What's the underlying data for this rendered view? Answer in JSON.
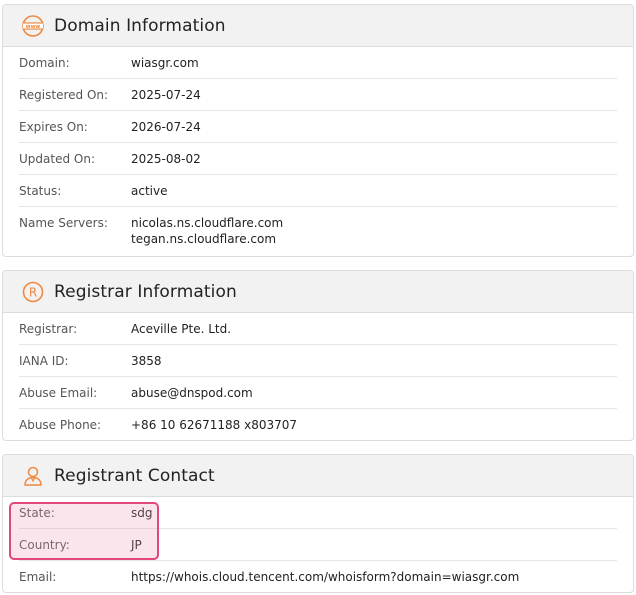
{
  "domain_info": {
    "title": "Domain Information",
    "icon": "www-globe-icon",
    "rows": [
      {
        "label": "Domain:",
        "value": "wiasgr.com"
      },
      {
        "label": "Registered On:",
        "value": "2025-07-24"
      },
      {
        "label": "Expires On:",
        "value": "2026-07-24"
      },
      {
        "label": "Updated On:",
        "value": "2025-08-02"
      },
      {
        "label": "Status:",
        "value": "active"
      }
    ],
    "name_servers": {
      "label": "Name Servers:",
      "values": [
        "nicolas.ns.cloudflare.com",
        "tegan.ns.cloudflare.com"
      ]
    }
  },
  "registrar_info": {
    "title": "Registrar Information",
    "icon": "registered-trademark-icon",
    "rows": [
      {
        "label": "Registrar:",
        "value": "Aceville Pte. Ltd."
      },
      {
        "label": "IANA ID:",
        "value": "3858"
      },
      {
        "label": "Abuse Email:",
        "value": "abuse@dnspod.com"
      },
      {
        "label": "Abuse Phone:",
        "value": "+86 10 62671188 x803707"
      }
    ]
  },
  "registrant_contact": {
    "title": "Registrant Contact",
    "icon": "person-icon",
    "rows": [
      {
        "label": "State:",
        "value": "sdg"
      },
      {
        "label": "Country:",
        "value": "JP"
      },
      {
        "label": "Email:",
        "value": "https://whois.cloud.tencent.com/whoisform?domain=wiasgr.com"
      }
    ]
  },
  "colors": {
    "accent_icon": "#f0883e",
    "highlight_border": "#e0487a"
  }
}
